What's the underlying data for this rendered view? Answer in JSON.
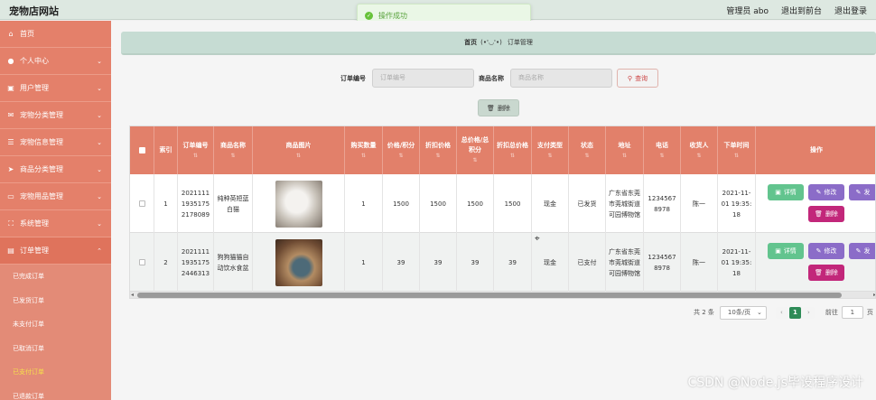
{
  "header": {
    "site_title": "宠物店网站",
    "admin_label": "管理员 abo",
    "back_front": "退出到前台",
    "logout": "退出登录"
  },
  "toast": {
    "message": "操作成功"
  },
  "sidebar": {
    "items": [
      {
        "label": "首页",
        "icon": "home-icon"
      },
      {
        "label": "个人中心",
        "icon": "user-icon"
      },
      {
        "label": "用户管理",
        "icon": "users-icon"
      },
      {
        "label": "宠物分类管理",
        "icon": "mail-icon"
      },
      {
        "label": "宠物信息管理",
        "icon": "list-icon"
      },
      {
        "label": "商品分类管理",
        "icon": "send-icon"
      },
      {
        "label": "宠物用品管理",
        "icon": "monitor-icon"
      },
      {
        "label": "系统管理",
        "icon": "settings-icon"
      },
      {
        "label": "订单管理",
        "icon": "order-icon"
      }
    ],
    "sub_items": [
      "已完成订单",
      "已发货订单",
      "未支付订单",
      "已取消订单",
      "已支付订单",
      "已退款订单"
    ]
  },
  "breadcrumb": {
    "home": "首页",
    "face": "(•'◡'•)",
    "current": "订单管理"
  },
  "search": {
    "order_no_label": "订单编号",
    "order_no_placeholder": "订单编号",
    "product_label": "商品名称",
    "product_placeholder": "商品名称",
    "search_button": "查询",
    "delete_button": "删除"
  },
  "table": {
    "headers": [
      "索引",
      "订单编号",
      "商品名称",
      "商品图片",
      "购买数量",
      "价格/积分",
      "折扣价格",
      "总价格/总积分",
      "折扣总价格",
      "支付类型",
      "状态",
      "地址",
      "电话",
      "收货人",
      "下单时间",
      "操作"
    ],
    "rows": [
      {
        "index": "1",
        "order_no": "20211111935175 2178089",
        "product": "纯种英短蓝白猫",
        "image": "kitten",
        "qty": "1",
        "price": "1500",
        "discount_price": "1500",
        "total": "1500",
        "discount_total": "1500",
        "pay_type": "现金",
        "status": "已发货",
        "address": "广东省东莞市莞城街道可园博物馆",
        "phone": "12345678978",
        "receiver": "陈一",
        "time": "2021-11-01 19:35:18"
      },
      {
        "index": "2",
        "order_no": "20211111935175 2446313",
        "product": "狗狗猫猫自动饮水食盆",
        "image": "feeder",
        "qty": "1",
        "price": "39",
        "discount_price": "39",
        "total": "39",
        "discount_total": "39",
        "pay_type": "现金",
        "status": "已支付",
        "address": "广东省东莞市莞城街道可园博物馆",
        "phone": "12345678978",
        "receiver": "陈一",
        "time": "2021-11-01 19:35:18"
      }
    ],
    "action_detail": "详情",
    "action_edit": "修改",
    "action_edit_cut": "发",
    "action_delete": "删除"
  },
  "pagination": {
    "total": "共 2 条",
    "page_size": "10条/页",
    "current_page": "1",
    "goto_label": "前往",
    "goto_value": "1",
    "page_unit": "页"
  },
  "watermark": "CSDN @Node.js毕设程序设计",
  "colors": {
    "sidebar": "#e4806a",
    "table_header": "#e2806a",
    "detail": "#62c48e",
    "edit": "#8b6cc8",
    "delete": "#c2277a"
  }
}
